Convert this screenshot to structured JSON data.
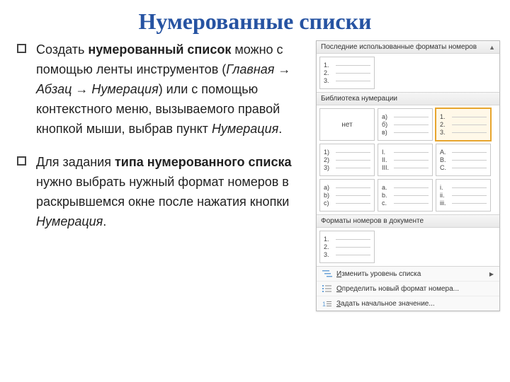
{
  "title": "Нумерованные списки",
  "bullets": [
    {
      "parts": [
        {
          "text": "Создать ",
          "cls": ""
        },
        {
          "text": "нумерованный список",
          "cls": "bold"
        },
        {
          "text": " можно с помощью ленты инструментов (",
          "cls": ""
        },
        {
          "text": "Главная → Абзац → Нумерация",
          "cls": "ital"
        },
        {
          "text": ") или с помощью контекстного меню, вызываемого правой кнопкой мыши, выбрав пункт ",
          "cls": ""
        },
        {
          "text": "Нумерация",
          "cls": "ital"
        },
        {
          "text": ".",
          "cls": ""
        }
      ]
    },
    {
      "parts": [
        {
          "text": "Для задания ",
          "cls": ""
        },
        {
          "text": "типа нумерованного списка",
          "cls": "bold"
        },
        {
          "text": " нужно выбрать нужный формат номеров в раскрывшемся окне после нажатия кнопки ",
          "cls": ""
        },
        {
          "text": "Нумерация",
          "cls": "ital"
        },
        {
          "text": ".",
          "cls": ""
        }
      ]
    }
  ],
  "panel": {
    "sections": {
      "recent": "Последние использованные форматы номеров",
      "library": "Библиотека нумерации",
      "indoc": "Форматы номеров в документе"
    },
    "tiles": {
      "recent": [
        [
          "1.",
          "2.",
          "3."
        ]
      ],
      "library_row1_none": "нет",
      "library": [
        [
          "а)",
          "б)",
          "в)"
        ],
        [
          "1.",
          "2.",
          "3."
        ],
        [
          "1)",
          "2)",
          "3)"
        ],
        [
          "I.",
          "II.",
          "III."
        ],
        [
          "A.",
          "B.",
          "C."
        ],
        [
          "a)",
          "b)",
          "c)"
        ],
        [
          "a.",
          "b.",
          "c."
        ],
        [
          "i.",
          "ii.",
          "iii."
        ]
      ],
      "indoc": [
        [
          "1.",
          "2.",
          "3."
        ]
      ]
    },
    "selected_index": 1,
    "footer": [
      {
        "label": "Изменить уровень списка",
        "mnemonic": 0,
        "chevron": true
      },
      {
        "label": "Определить новый формат номера...",
        "mnemonic": 0,
        "chevron": false
      },
      {
        "label": "Задать начальное значение...",
        "mnemonic": 0,
        "chevron": false
      }
    ]
  }
}
